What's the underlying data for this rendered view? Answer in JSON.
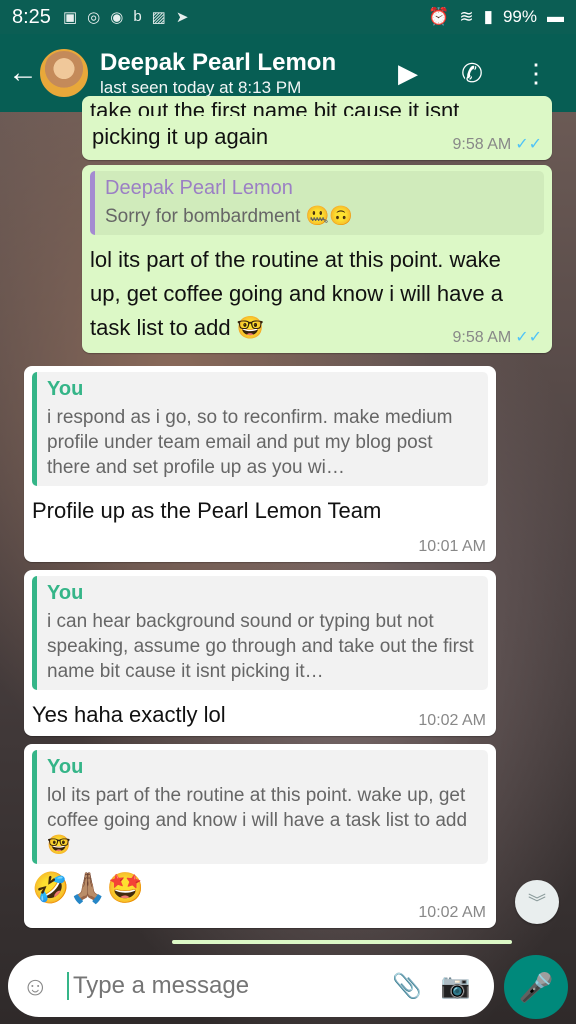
{
  "status": {
    "time": "8:25",
    "battery": "99%"
  },
  "header": {
    "contact_name": "Deepak Pearl Lemon",
    "last_seen": "last seen today at 8:13 PM"
  },
  "messages": [
    {
      "direction": "out",
      "partial_text": "take out the first name bit cause it isnt",
      "text": "picking it up again",
      "time": "9:58 AM",
      "status": "read"
    },
    {
      "direction": "out",
      "quote_author": "Deepak Pearl Lemon",
      "quote_text": "Sorry for bombardment 🤐🙃",
      "text": "lol its part of the routine at this point. wake up, get coffee going and know i will have a task list to add 🤓",
      "time": "9:58 AM",
      "status": "read"
    },
    {
      "direction": "in",
      "quote_author": "You",
      "quote_text": "i respond as i go, so to reconfirm. make medium profile under team email and put my blog post there and set profile up as you wi…",
      "text": "Profile up as the Pearl Lemon Team",
      "time": "10:01 AM"
    },
    {
      "direction": "in",
      "quote_author": "You",
      "quote_text": "i can hear background sound or typing but not speaking, assume go through and take out the first name bit cause it isnt picking it…",
      "text": "Yes haha exactly lol",
      "time": "10:02 AM"
    },
    {
      "direction": "in",
      "quote_author": "You",
      "quote_text": "lol its part of the routine at this point. wake up, get coffee going and know i will have a task list to add 🤓",
      "text": "🤣🙏🏽🤩",
      "time": "10:02 AM"
    }
  ],
  "composer": {
    "placeholder": "Type a message"
  },
  "icons": {
    "read_ticks": "✓✓",
    "back": "back-arrow-icon",
    "video": "video-camera-icon",
    "call": "phone-icon",
    "menu": "more-vert-icon",
    "emoji": "emoji-icon",
    "attach": "paperclip-icon",
    "camera": "camera-icon",
    "mic": "microphone-icon",
    "scroll": "chevron-double-down-icon"
  },
  "colors": {
    "header": "#075e54",
    "outgoing": "#dcf8c6",
    "incoming": "#ffffff",
    "accent": "#00897b"
  }
}
